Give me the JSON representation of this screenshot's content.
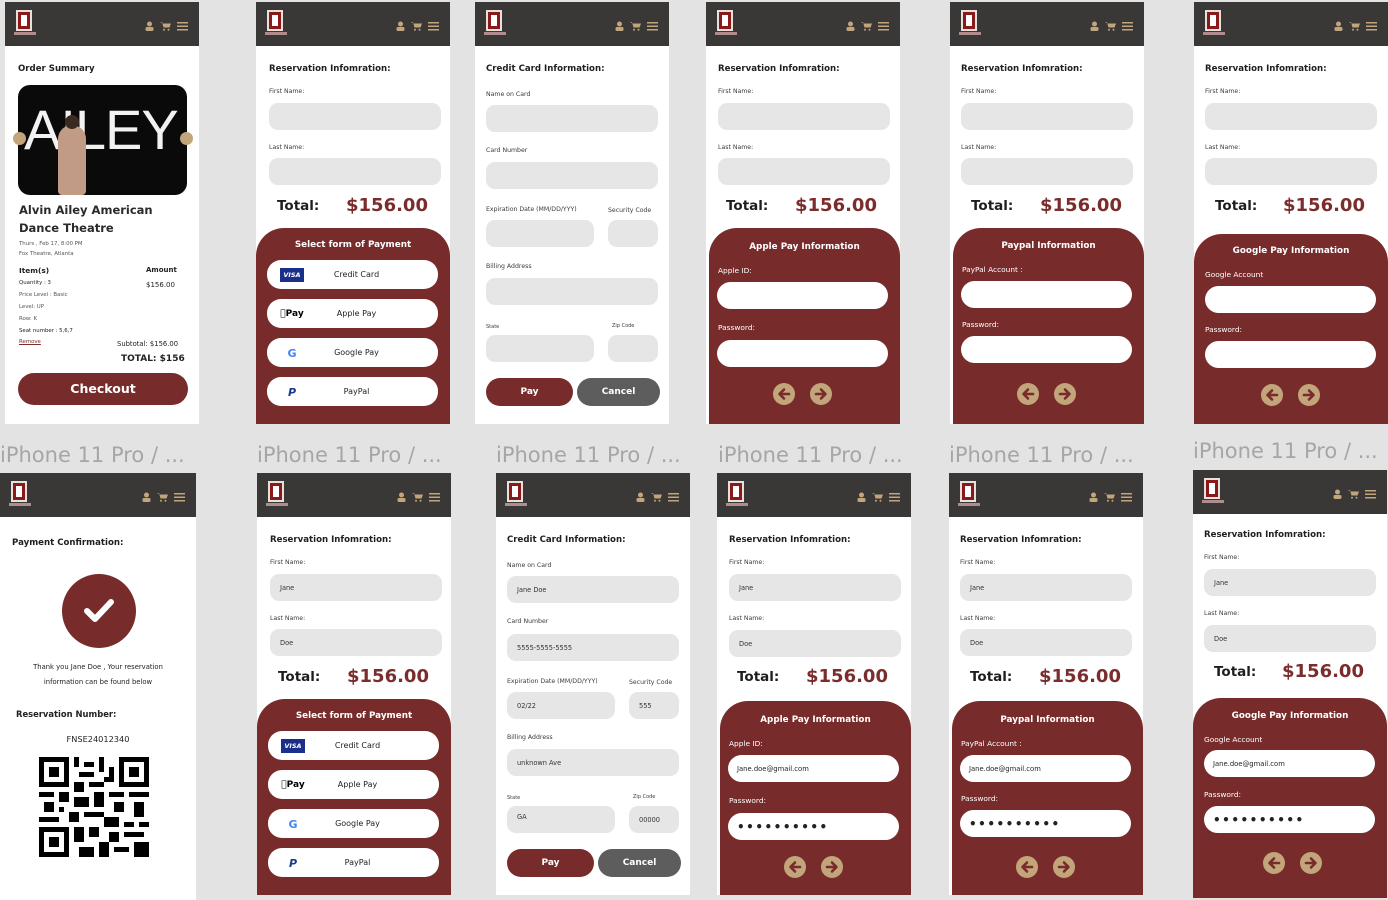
{
  "captions": [
    "iPhone 11 Pro / ...",
    "iPhone 11 Pro / ...",
    "iPhone 11 Pro / ...",
    "iPhone 11 Pro / ...",
    "iPhone 11 Pro / ...",
    "iPhone 11 Pro / ..."
  ],
  "common": {
    "reservation_title": "Reservation Infomration:",
    "first_name_label": "First Name:",
    "last_name_label": "Last Name:",
    "total_label": "Total:",
    "total_value": "$156.00",
    "password_label": "Password:",
    "password_mask": "••••••••••"
  },
  "order_summary": {
    "title": "Order Summary",
    "hero_text": "AILEY",
    "show_title": "Alvin Ailey American Dance Theatre",
    "datetime": "Thurs , Feb 17, 8:00 PM",
    "venue": "Fox Theatre, Atlanta",
    "items_header": "Item(s)",
    "amount_header": "Amount",
    "quantity": "Quantity : 3",
    "price_level": "Price Level : Basic",
    "level": "Level: UP",
    "row": "Row: K",
    "seat": "Seat number : 5,6,7",
    "remove": "Remove",
    "amount": "$156.00",
    "subtotal": "Subtotal: $156.00",
    "total": "TOTAL: $156",
    "checkout": "Checkout"
  },
  "payment_select": {
    "title": "Select form of Payment",
    "options": [
      {
        "icon": "visa-icon",
        "label": "Credit Card"
      },
      {
        "icon": "apple-pay-icon",
        "label": "Apple Pay"
      },
      {
        "icon": "google-icon",
        "label": "Google Pay"
      },
      {
        "icon": "paypal-icon",
        "label": "PayPal"
      }
    ]
  },
  "credit_card": {
    "title": "Credit Card Information:",
    "name_label": "Name on Card",
    "number_label": "Card Number",
    "exp_label": "Expiration Date (MM/DD/YYY)",
    "sec_label": "Security Code",
    "billing_label": "Billing Address",
    "state_label": "State",
    "zip_label": "Zip Code",
    "pay": "Pay",
    "cancel": "Cancel",
    "filled": {
      "name": "Jane Doe",
      "number": "5555-5555-5555",
      "exp": "02/22",
      "sec": "555",
      "billing": "unknown Ave",
      "state": "GA",
      "zip": "00000"
    }
  },
  "apple_pay": {
    "title": "Apple Pay Information",
    "id_label": "Apple ID:",
    "id_value": "Jane.doe@gmail.com"
  },
  "paypal": {
    "title": "Paypal Information",
    "id_label": "PayPal Account :",
    "id_value": "Jane.doe@gmail.com"
  },
  "google_pay": {
    "title": "Google Pay Information",
    "id_label": "Google Account",
    "id_value": "Jane.doe@gmail.com"
  },
  "filled_names": {
    "first": "Jane",
    "last": "Doe"
  },
  "confirmation": {
    "title": "Payment Confirmation:",
    "thanks_line1": "Thank you  Jane Doe , Your  reservation",
    "thanks_line2": "information  can be found below",
    "res_label": "Reservation Number:",
    "res_number": "FNSE24012340"
  },
  "colors": {
    "brand": "#782b2b",
    "header": "#3a3737",
    "accent": "#c3a57b"
  }
}
